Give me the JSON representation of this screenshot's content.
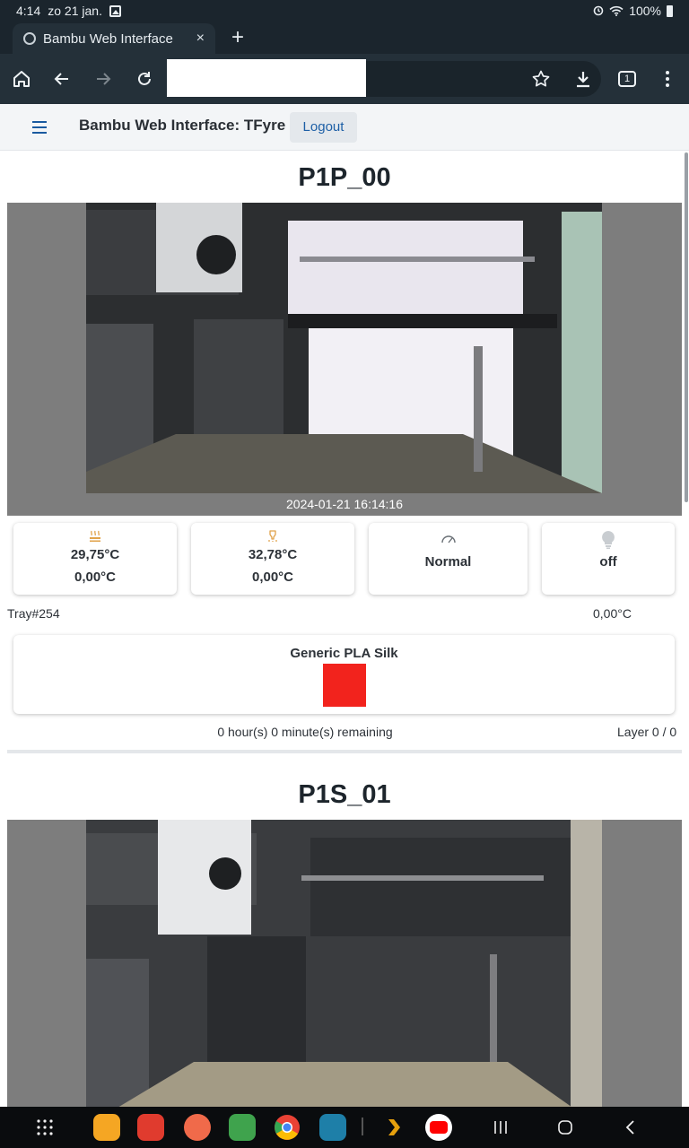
{
  "status_bar": {
    "time": "4:14",
    "date": "zo 21 jan.",
    "battery": "100%"
  },
  "browser": {
    "tab_title": "Bambu Web Interface",
    "tab_close": "×",
    "new_tab": "+",
    "tab_count": "1"
  },
  "app": {
    "title": "Bambu Web Interface: TFyre",
    "logout_label": "Logout"
  },
  "printers": [
    {
      "name": "P1P_00",
      "timestamp": "2024-01-21 16:14:16",
      "bed_temp": "29,75°C",
      "bed_target": "0,00°C",
      "nozzle_temp": "32,78°C",
      "nozzle_target": "0,00°C",
      "speed": "Normal",
      "light": "off",
      "tray": "Tray#254",
      "tray_temp": "0,00°C",
      "filament": "Generic PLA Silk",
      "filament_color": "#f2231d",
      "remaining": "0 hour(s) 0 minute(s) remaining",
      "layer": "Layer 0 / 0"
    },
    {
      "name": "P1S_01"
    }
  ],
  "icons": {
    "bed": "heatbed-icon",
    "nozzle": "nozzle-icon",
    "speed": "speedometer-icon",
    "light": "lightbulb-icon"
  },
  "colors": {
    "accent": "#1d5fa6",
    "status_bar": "#1b252d",
    "toolbar": "#243039",
    "camera_bg": "#7d7d7d",
    "heat_icon": "#e0a24a"
  }
}
